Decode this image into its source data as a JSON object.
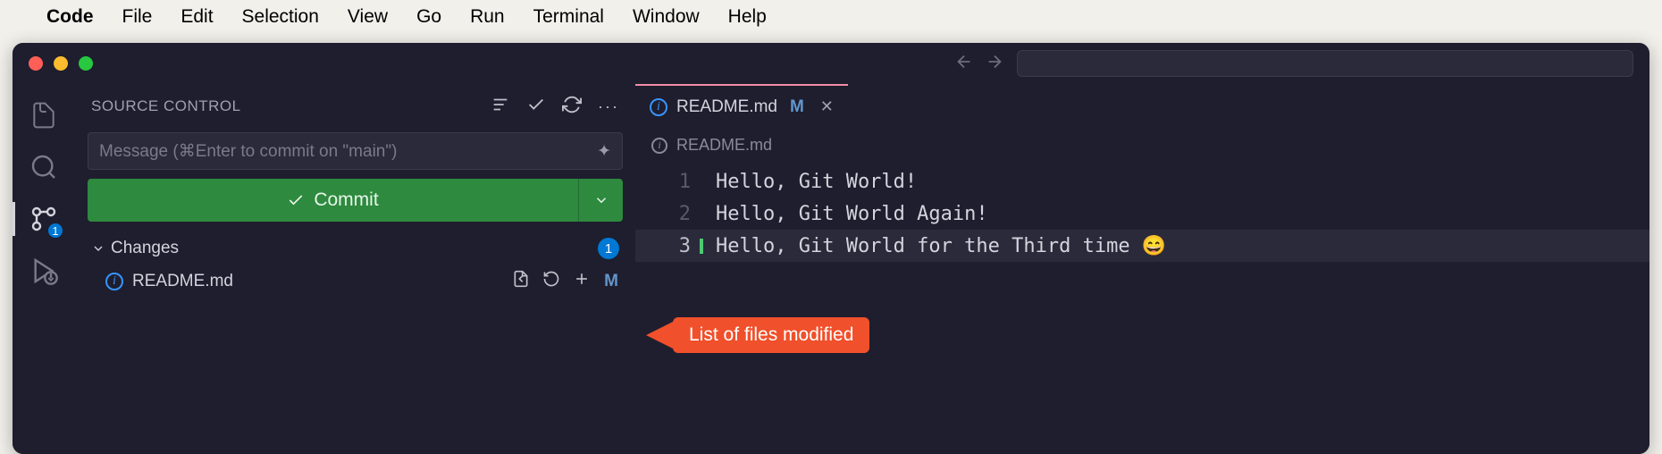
{
  "menubar": {
    "app_name": "Code",
    "items": [
      "File",
      "Edit",
      "Selection",
      "View",
      "Go",
      "Run",
      "Terminal",
      "Window",
      "Help"
    ]
  },
  "activity_bar": {
    "source_control_badge": "1"
  },
  "sidebar": {
    "title": "SOURCE CONTROL",
    "commit_placeholder": "Message (⌘Enter to commit on \"main\")",
    "commit_button": "Commit",
    "changes": {
      "label": "Changes",
      "count": "1",
      "files": [
        {
          "name": "README.md",
          "status": "M"
        }
      ]
    }
  },
  "editor": {
    "tab": {
      "filename": "README.md",
      "status": "M"
    },
    "breadcrumb": "README.md",
    "lines": [
      {
        "num": "1",
        "text": "Hello, Git World!"
      },
      {
        "num": "2",
        "text": "Hello, Git World Again!"
      },
      {
        "num": "3",
        "text": "Hello, Git World for the Third time 😄"
      }
    ]
  },
  "callout": "List of files modified"
}
